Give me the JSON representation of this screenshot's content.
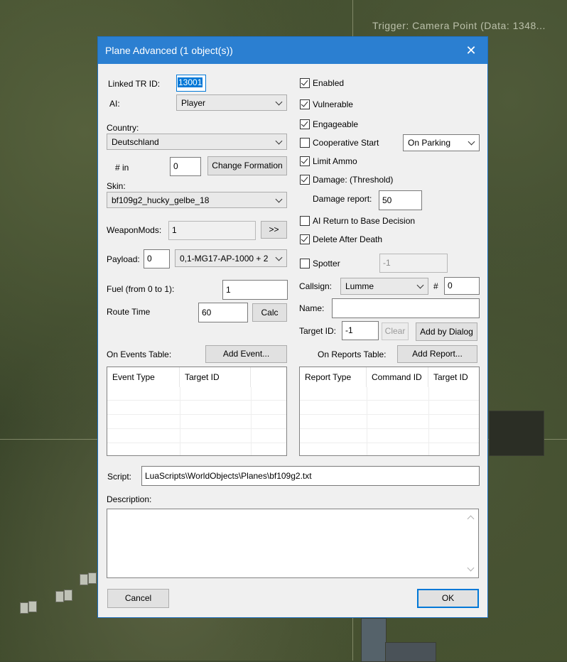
{
  "background": {
    "map_label": "Trigger: Camera Point (Data: 1348..."
  },
  "dialog": {
    "title": "Plane Advanced (1 object(s))",
    "linked_tr_label": "Linked TR ID:",
    "linked_tr_value": "13001",
    "ai_label": "AI:",
    "ai_value": "Player",
    "country_label": "Country:",
    "country_value": "Deutschland",
    "num_in_label": "# in",
    "num_in_value": "0",
    "change_formation_label": "Change Formation",
    "skin_label": "Skin:",
    "skin_value": "bf109g2_hucky_gelbe_18",
    "weaponmods_label": "WeaponMods:",
    "weaponmods_value": "1",
    "weaponmods_button": ">>",
    "payload_label": "Payload:",
    "payload_value": "0",
    "payload_select": "0,1-MG17-AP-1000 + 2",
    "fuel_label": "Fuel (from 0 to 1):",
    "fuel_value": "1",
    "route_time_label": "Route Time",
    "route_time_value": "60",
    "calc_label": "Calc",
    "enabled_label": "Enabled",
    "vulnerable_label": "Vulnerable",
    "engageable_label": "Engageable",
    "coop_start_label": "Cooperative Start",
    "coop_start_select": "On Parking",
    "limit_ammo_label": "Limit Ammo",
    "damage_label": "Damage: (Threshold)",
    "damage_report_label": "Damage report:",
    "damage_report_value": "50",
    "ai_return_label": "AI Return to Base Decision",
    "delete_after_death_label": "Delete After Death",
    "spotter_label": "Spotter",
    "spotter_value": "-1",
    "callsign_label": "Callsign:",
    "callsign_value": "Lumme",
    "hash_label": "#",
    "callsign_num": "0",
    "name_label": "Name:",
    "name_value": "",
    "target_id_label": "Target ID:",
    "target_id_value": "-1",
    "clear_label": "Clear",
    "add_by_dialog_label": "Add by Dialog",
    "events_table_label": "On Events Table:",
    "add_event_label": "Add Event...",
    "events_columns": [
      "Event Type",
      "Target ID"
    ],
    "reports_table_label": "On Reports Table:",
    "add_report_label": "Add Report...",
    "reports_columns": [
      "Report Type",
      "Command ID",
      "Target ID"
    ],
    "script_label": "Script:",
    "script_value": "LuaScripts\\WorldObjects\\Planes\\bf109g2.txt",
    "description_label": "Description:",
    "description_value": "",
    "cancel_label": "Cancel",
    "ok_label": "OK"
  },
  "checkboxes": {
    "enabled": true,
    "vulnerable": true,
    "engageable": true,
    "cooperative_start": false,
    "limit_ammo": true,
    "damage_threshold": true,
    "ai_return": false,
    "delete_after_death": true,
    "spotter": false
  },
  "icons": {
    "close": "close-icon",
    "dropdown": "chevron-down-icon"
  }
}
